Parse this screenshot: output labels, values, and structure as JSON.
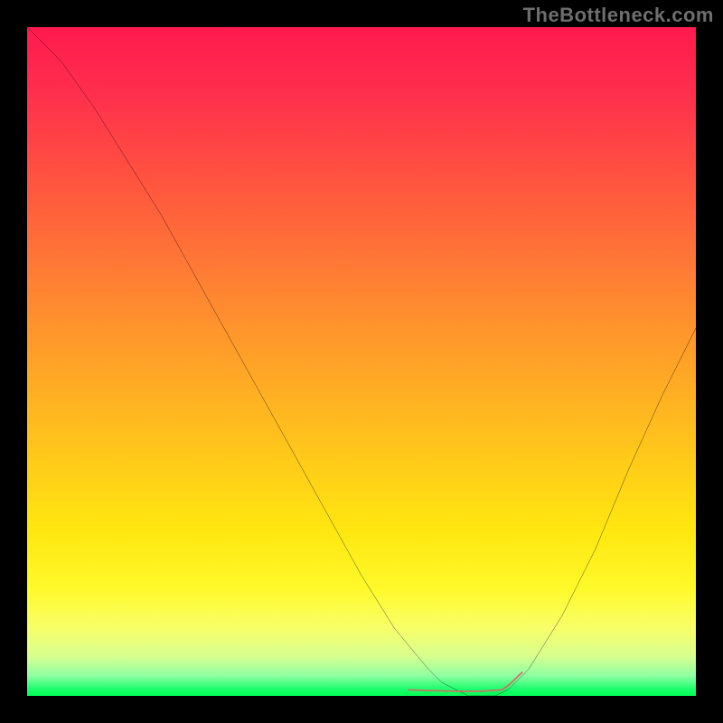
{
  "watermark": "TheBottleneck.com",
  "chart_data": {
    "type": "line",
    "title": "",
    "xlabel": "",
    "ylabel": "",
    "xlim": [
      0,
      100
    ],
    "ylim": [
      0,
      100
    ],
    "background": {
      "type": "vertical-gradient",
      "stops": [
        {
          "pos": 0,
          "color": "#ff1a4d"
        },
        {
          "pos": 10,
          "color": "#ff2f4d"
        },
        {
          "pos": 22,
          "color": "#ff5140"
        },
        {
          "pos": 36,
          "color": "#ff7a35"
        },
        {
          "pos": 50,
          "color": "#ffa227"
        },
        {
          "pos": 64,
          "color": "#ffc81a"
        },
        {
          "pos": 75,
          "color": "#ffe60f"
        },
        {
          "pos": 84,
          "color": "#fff92a"
        },
        {
          "pos": 90,
          "color": "#f7ff6a"
        },
        {
          "pos": 94,
          "color": "#d8ff8e"
        },
        {
          "pos": 97,
          "color": "#8effa2"
        },
        {
          "pos": 99,
          "color": "#1bff6d"
        },
        {
          "pos": 100,
          "color": "#00ff55"
        }
      ]
    },
    "series": [
      {
        "name": "bottleneck-curve",
        "color": "#000000",
        "stroke_width": 2,
        "x": [
          0.0,
          5,
          10,
          15,
          20,
          25,
          30,
          35,
          40,
          45,
          50,
          55,
          60,
          62,
          66,
          70,
          72,
          75,
          80,
          85,
          90,
          95,
          100
        ],
        "values": [
          100,
          95,
          88,
          80,
          72,
          63,
          54,
          45,
          36,
          27,
          18,
          10,
          4,
          2,
          0,
          0,
          1,
          4,
          12,
          22,
          34,
          45,
          55
        ]
      },
      {
        "name": "optimal-range-marker",
        "color": "#d86a60",
        "stroke_width": 10,
        "x": [
          57,
          60,
          64,
          68,
          71,
          72,
          74
        ],
        "values": [
          0.9,
          0.8,
          0.7,
          0.7,
          0.9,
          1.6,
          3.5
        ]
      }
    ],
    "annotations": []
  }
}
